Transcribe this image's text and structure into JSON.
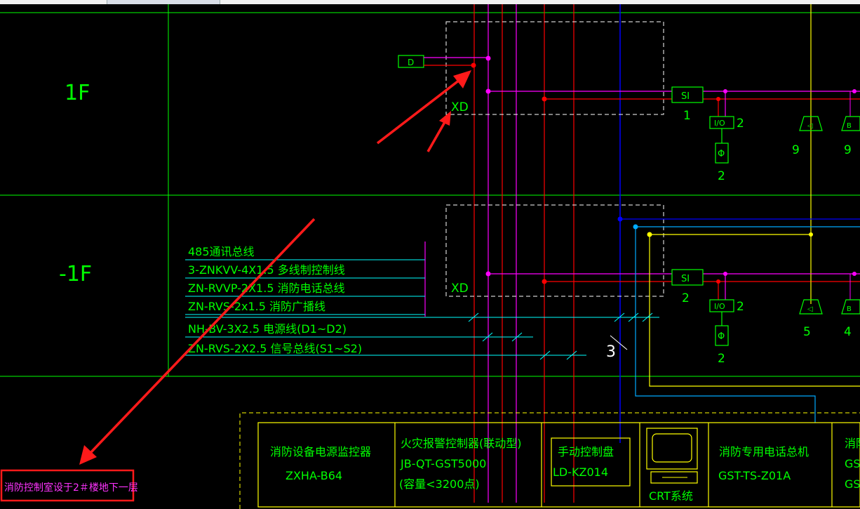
{
  "floors": {
    "first": "1F",
    "basement": "-1F"
  },
  "cabinets": {
    "xd_top": "XD",
    "xd_bottom": "XD",
    "d_box": "D"
  },
  "modules": {
    "si_top": "SI",
    "si_bottom": "SI",
    "io_top": "I/O",
    "io_bottom": "I/O",
    "phone_symbol": "Φ",
    "speaker_symbol": "◁",
    "bell_symbol": "B"
  },
  "counts": {
    "si_top": "1",
    "io_top": "2",
    "phone_top": "2",
    "speaker_top": "9",
    "bell_top": "9",
    "si_bottom": "2",
    "io_bottom": "2",
    "phone_bottom": "2",
    "speaker_bottom": "5",
    "bell_bottom": "4",
    "bundle": "3"
  },
  "legend": [
    "485通讯总线",
    "3-ZNKVV-4X1.5  多线制控制线",
    "ZN-RVVP-2X1.5  消防电话总线",
    "ZN-RVS-2x1.5  消防广播线",
    "NH-BV-3X2.5  电源线(D1~D2)",
    "ZN-RVS-2X2.5  信号总线(S1~S2)"
  ],
  "equipment": {
    "power_monitor": {
      "name": "消防设备电源监控器",
      "model": "ZXHA-B64"
    },
    "fire_alarm": {
      "name": "火灾报警控制器(联动型)",
      "model": "JB-QT-GST5000",
      "capacity": "(容量<3200点)"
    },
    "manual_panel": {
      "name": "手动控制盘",
      "model": "LD-KZ014"
    },
    "crt": {
      "name": "CRT系统"
    },
    "phone_host": {
      "name": "消防专用电话总机",
      "model": "GST-TS-Z01A"
    },
    "cut_off": {
      "name": "消防",
      "line2": "GST",
      "line3": "GS"
    }
  },
  "annotation": "消防控制室设于2＃楼地下一层",
  "colors": {
    "green": "#00ff00",
    "red": "#ff0000",
    "magenta": "#ff00ff",
    "yellow": "#ffff00",
    "cyan": "#00ffff",
    "blue": "#0000ff",
    "sky": "#00aaff",
    "darkred": "#c80000",
    "white": "#ffffff"
  }
}
